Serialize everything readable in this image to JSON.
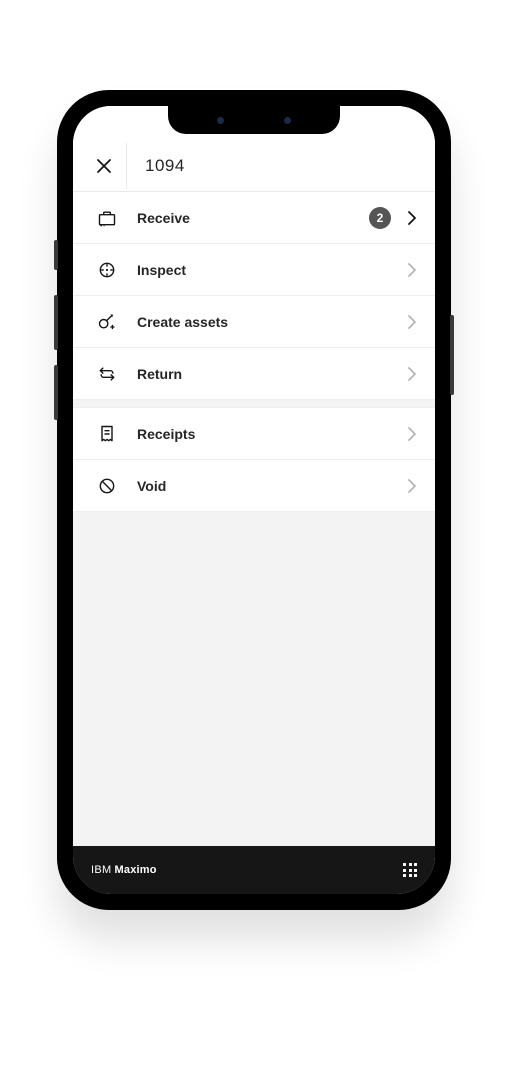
{
  "header": {
    "title": "1094"
  },
  "menu": {
    "items": [
      {
        "key": "receive",
        "label": "Receive",
        "badge": "2"
      },
      {
        "key": "inspect",
        "label": "Inspect",
        "badge": null
      },
      {
        "key": "assets",
        "label": "Create assets",
        "badge": null
      },
      {
        "key": "return",
        "label": "Return",
        "badge": null
      },
      {
        "key": "receipts",
        "label": "Receipts",
        "badge": null
      },
      {
        "key": "void",
        "label": "Void",
        "badge": null
      }
    ]
  },
  "footer": {
    "brand_prefix": "IBM",
    "brand_name": "Maximo"
  }
}
